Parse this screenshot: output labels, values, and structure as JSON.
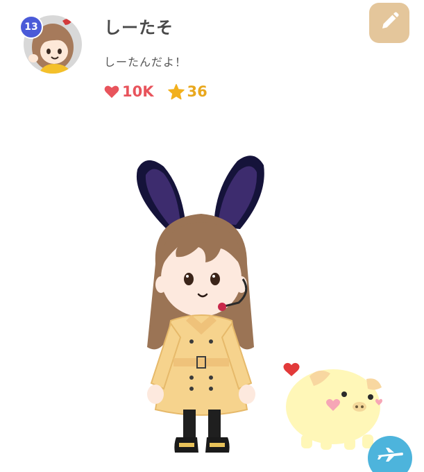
{
  "profile": {
    "level": "13",
    "name": "しーたそ",
    "bio": "しーたんだよ！",
    "likes": "10K",
    "stars": "36"
  },
  "icons": {
    "likes": "heart-icon",
    "stars": "star-icon",
    "edit": "pencil-icon",
    "fab": "airplane-icon"
  },
  "colors": {
    "level_badge": "#4a5ad8",
    "likes": "#e8545c",
    "stars": "#e9a81e",
    "edit_button": "#e4c69b",
    "fab": "#4db4dc"
  }
}
